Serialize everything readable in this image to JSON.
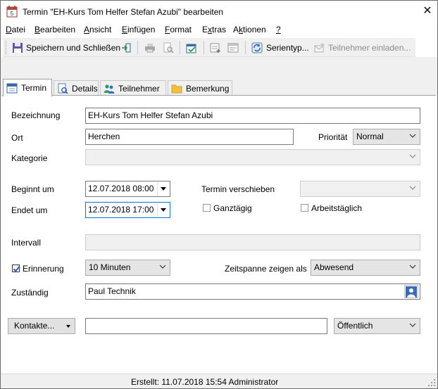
{
  "window": {
    "title": "Termin \"EH-Kurs Tom Helfer Stefan Azubi\" bearbeiten"
  },
  "menu": [
    {
      "label": "Datei",
      "accel": "D"
    },
    {
      "label": "Bearbeiten",
      "accel": "B"
    },
    {
      "label": "Ansicht",
      "accel": "A"
    },
    {
      "label": "Einfügen",
      "accel": "E"
    },
    {
      "label": "Format",
      "accel": "F"
    },
    {
      "label": "Extras",
      "accel": "x"
    },
    {
      "label": "Aktionen",
      "accel": "k"
    },
    {
      "label": "?",
      "accel": "?"
    }
  ],
  "toolbar": {
    "save_close_label": "Speichern und Schließen",
    "recurrence_label": "Serientyp...",
    "invite_label": "Teilnehmer einladen..."
  },
  "tabs": [
    {
      "label": "Termin",
      "icon": "calendar-icon",
      "active": true
    },
    {
      "label": "Details",
      "icon": "details-icon",
      "active": false
    },
    {
      "label": "Teilnehmer",
      "icon": "participants-icon",
      "active": false
    },
    {
      "label": "Bemerkung",
      "icon": "note-folder-icon",
      "active": false
    }
  ],
  "form": {
    "bezeichnung_label": "Bezeichnung",
    "bezeichnung_value": "EH-Kurs Tom Helfer Stefan Azubi",
    "ort_label": "Ort",
    "ort_value": "Herchen",
    "prioritaet_label": "Priorität",
    "prioritaet_value": "Normal",
    "kategorie_label": "Kategorie",
    "kategorie_value": "",
    "beginnt_label": "Beginnt um",
    "beginnt_value": "12.07.2018 08:00",
    "endet_label": "Endet um",
    "endet_value": "12.07.2018 17:00",
    "verschieben_label": "Termin verschieben",
    "verschieben_value": "",
    "ganztaegig_label": "Ganztägig",
    "ganztaegig_checked": false,
    "arbeitstaeglich_label": "Arbeitstäglich",
    "arbeitstaeglich_checked": false,
    "intervall_label": "Intervall",
    "intervall_value": "",
    "erinnerung_label": "Erinnerung",
    "erinnerung_checked": true,
    "erinnerung_value": "10 Minuten",
    "zeitspanne_label": "Zeitspanne zeigen als",
    "zeitspanne_value": "Abwesend",
    "zustaendig_label": "Zuständig",
    "zustaendig_value": "Paul Technik",
    "kontakte_button": "Kontakte...",
    "kontakte_value": "",
    "sichtbarkeit_value": "Öffentlich"
  },
  "status": {
    "text": "Erstellt: 11.07.2018 15:54 Administrator"
  },
  "colors": {
    "accent": "#0078d7",
    "toolbar_bg": "#f0f0f0"
  }
}
